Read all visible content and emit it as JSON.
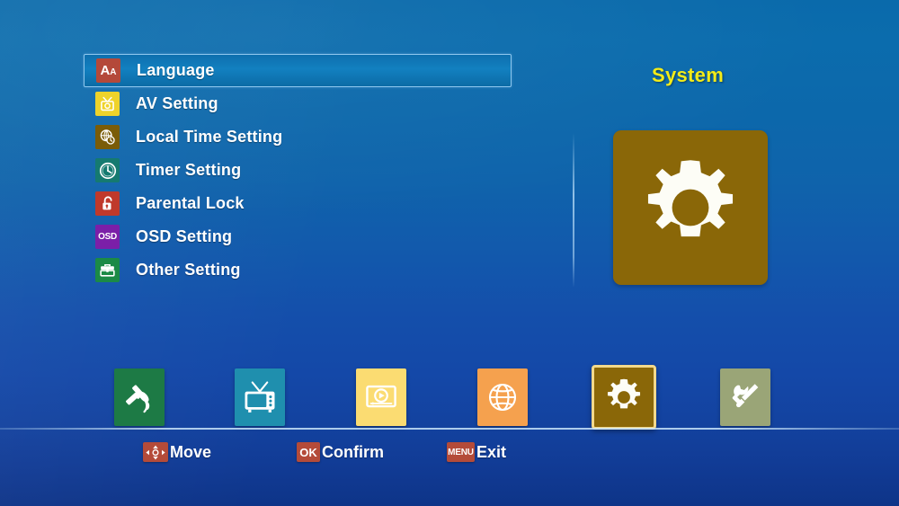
{
  "page": {
    "title": "System",
    "title_color": "#f2eb19",
    "background_top_color": "#0a6aab",
    "background_bottom_color": "#0e3488"
  },
  "menu": {
    "selected_index": 0,
    "items": [
      {
        "label": "Language",
        "icon": "letters-aa-icon",
        "icon_color": "#b4493a",
        "selected": true
      },
      {
        "label": "AV Setting",
        "icon": "tv-camera-icon",
        "icon_color": "#efd32a",
        "selected": false
      },
      {
        "label": "Local Time Setting",
        "icon": "globe-clock-icon",
        "icon_color": "#7a5c08",
        "selected": false
      },
      {
        "label": "Timer Setting",
        "icon": "clock-icon",
        "icon_color": "#157a70",
        "selected": false
      },
      {
        "label": "Parental Lock",
        "icon": "open-lock-icon",
        "icon_color": "#c0392b",
        "selected": false
      },
      {
        "label": "OSD Setting",
        "icon": "osd-text-icon",
        "icon_color": "#7b1fa8",
        "selected": false
      },
      {
        "label": "Other Setting",
        "icon": "toolbox-icon",
        "icon_color": "#1b8a46",
        "selected": false
      }
    ]
  },
  "detail_panel": {
    "icon": "gear-icon",
    "tile_color": "#8a6708",
    "glyph_color": "#fdfdf6"
  },
  "bottom_bar": {
    "items": [
      {
        "name": "installation",
        "icon": "satellite-dish-icon",
        "tile_color": "#1d7a45",
        "active": false
      },
      {
        "name": "channel",
        "icon": "television-icon",
        "tile_color": "#1f8fae",
        "active": false
      },
      {
        "name": "media",
        "icon": "media-player-icon",
        "tile_color": "#fbdc72",
        "active": false
      },
      {
        "name": "network",
        "icon": "globe-icon",
        "tile_color": "#f5a14e",
        "active": false
      },
      {
        "name": "system",
        "icon": "gear-icon",
        "tile_color": "#8a6708",
        "active": true
      },
      {
        "name": "tools",
        "icon": "wrench-screwdriver-icon",
        "tile_color": "#9aa577",
        "active": false
      }
    ]
  },
  "help_bar": {
    "items": [
      {
        "key": "",
        "key_icon": "dpad-arrows-icon",
        "label": "Move"
      },
      {
        "key": "OK",
        "key_icon": "",
        "label": "Confirm"
      },
      {
        "key": "MENU",
        "key_icon": "",
        "label": "Exit"
      }
    ],
    "key_badge_color": "#b44b39"
  }
}
